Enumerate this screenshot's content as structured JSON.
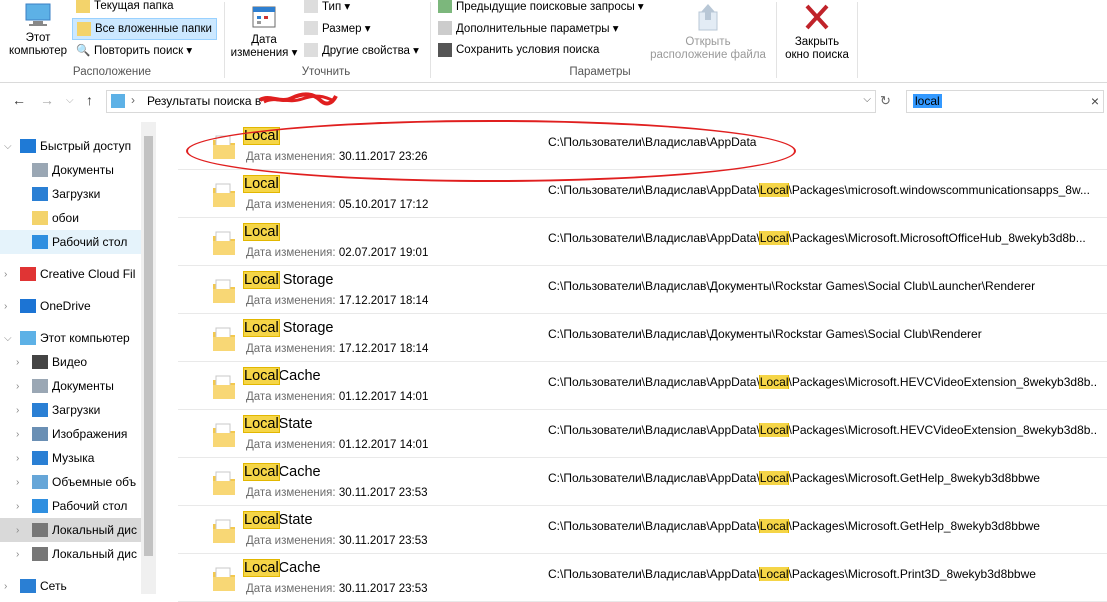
{
  "ribbon": {
    "this_pc_label": "Этот\nкомпьютер",
    "current_folder": "Текущая папка",
    "all_subfolders": "Все вложенные папки",
    "search_again": "Повторить поиск ▾",
    "location_group": "Расположение",
    "date_modified_label": "Дата\nизменения ▾",
    "type_label": "Тип ▾",
    "size_label": "Размер ▾",
    "other_props": "Другие свойства ▾",
    "refine_group": "Уточнить",
    "recent_searches": "Предыдущие поисковые запросы ▾",
    "advanced_options": "Дополнительные параметры ▾",
    "save_search": "Сохранить условия поиска",
    "open_location": "Открыть\nрасположение файла",
    "close_search": "Закрыть\nокно поиска",
    "options_group": "Параметры"
  },
  "address": {
    "path_text": "Результаты поиска в",
    "search_value": "local"
  },
  "nav": {
    "items": [
      {
        "label": "Быстрый доступ",
        "icon": "star-icon"
      },
      {
        "label": "Документы",
        "icon": "documents-icon"
      },
      {
        "label": "Загрузки",
        "icon": "downloads-icon"
      },
      {
        "label": "обои",
        "icon": "folder-icon"
      },
      {
        "label": "Рабочий стол",
        "icon": "desktop-icon"
      },
      {
        "label": "Creative Cloud Fil",
        "icon": "creative-cloud-icon"
      },
      {
        "label": "OneDrive",
        "icon": "cloud-icon"
      },
      {
        "label": "Этот компьютер",
        "icon": "computer-icon"
      },
      {
        "label": "Видео",
        "icon": "video-icon"
      },
      {
        "label": "Документы",
        "icon": "documents-icon"
      },
      {
        "label": "Загрузки",
        "icon": "downloads-icon"
      },
      {
        "label": "Изображения",
        "icon": "pictures-icon"
      },
      {
        "label": "Музыка",
        "icon": "music-icon"
      },
      {
        "label": "Объемные объ",
        "icon": "3d-objects-icon"
      },
      {
        "label": "Рабочий стол",
        "icon": "desktop-icon"
      },
      {
        "label": "Локальный дис",
        "icon": "drive-icon"
      },
      {
        "label": "Локальный дис",
        "icon": "drive-icon"
      },
      {
        "label": "Сеть",
        "icon": "network-icon"
      }
    ]
  },
  "results": {
    "date_label": "Дата изменения:",
    "rows": [
      {
        "match": "Local",
        "rest": "",
        "date": "30.11.2017 23:26",
        "path_pre": "C:\\Пользователи\\Владислав\\AppData",
        "path_hl": "",
        "path_post": ""
      },
      {
        "match": "Local",
        "rest": "",
        "date": "05.10.2017 17:12",
        "path_pre": "C:\\Пользователи\\Владислав\\AppData\\",
        "path_hl": "Local",
        "path_post": "\\Packages\\microsoft.windowscommunicationsapps_8w..."
      },
      {
        "match": "Local",
        "rest": "",
        "date": "02.07.2017 19:01",
        "path_pre": "C:\\Пользователи\\Владислав\\AppData\\",
        "path_hl": "Local",
        "path_post": "\\Packages\\Microsoft.MicrosoftOfficeHub_8wekyb3d8b..."
      },
      {
        "match": "Local",
        "rest": " Storage",
        "date": "17.12.2017 18:14",
        "path_pre": "C:\\Пользователи\\Владислав\\Документы\\Rockstar Games\\Social Club\\Launcher\\Renderer",
        "path_hl": "",
        "path_post": ""
      },
      {
        "match": "Local",
        "rest": " Storage",
        "date": "17.12.2017 18:14",
        "path_pre": "C:\\Пользователи\\Владислав\\Документы\\Rockstar Games\\Social Club\\Renderer",
        "path_hl": "",
        "path_post": ""
      },
      {
        "match": "Local",
        "rest": "Cache",
        "date": "01.12.2017 14:01",
        "path_pre": "C:\\Пользователи\\Владислав\\AppData\\",
        "path_hl": "Local",
        "path_post": "\\Packages\\Microsoft.HEVCVideoExtension_8wekyb3d8b..."
      },
      {
        "match": "Local",
        "rest": "State",
        "date": "01.12.2017 14:01",
        "path_pre": "C:\\Пользователи\\Владислав\\AppData\\",
        "path_hl": "Local",
        "path_post": "\\Packages\\Microsoft.HEVCVideoExtension_8wekyb3d8b..."
      },
      {
        "match": "Local",
        "rest": "Cache",
        "date": "30.11.2017 23:53",
        "path_pre": "C:\\Пользователи\\Владислав\\AppData\\",
        "path_hl": "Local",
        "path_post": "\\Packages\\Microsoft.GetHelp_8wekyb3d8bbwe"
      },
      {
        "match": "Local",
        "rest": "State",
        "date": "30.11.2017 23:53",
        "path_pre": "C:\\Пользователи\\Владислав\\AppData\\",
        "path_hl": "Local",
        "path_post": "\\Packages\\Microsoft.GetHelp_8wekyb3d8bbwe"
      },
      {
        "match": "Local",
        "rest": "Cache",
        "date": "30.11.2017 23:53",
        "path_pre": "C:\\Пользователи\\Владислав\\AppData\\",
        "path_hl": "Local",
        "path_post": "\\Packages\\Microsoft.Print3D_8wekyb3d8bbwe"
      }
    ]
  },
  "colors": {
    "highlight": "#f5d547",
    "annotation": "#e01f1f",
    "selection": "#3399ff"
  }
}
